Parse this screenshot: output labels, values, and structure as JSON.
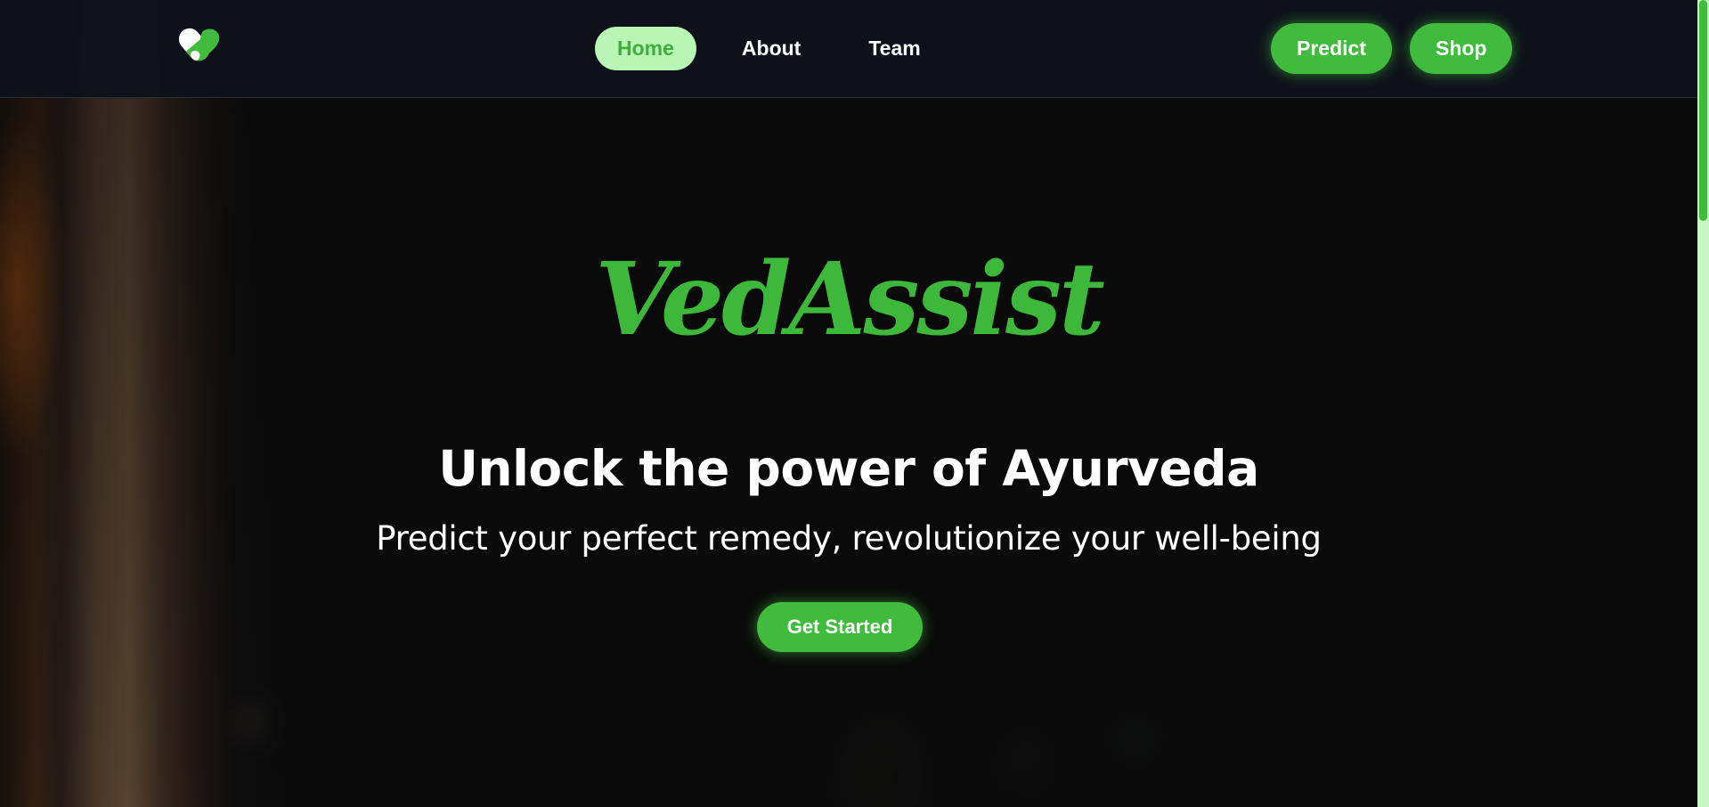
{
  "colors": {
    "accent": "#41bb3d",
    "accent_light": "#b9f5b5",
    "nav_background": "#0e121b",
    "page_background": "#0b0b0b",
    "text": "#ffffff"
  },
  "navbar": {
    "logo_icon": "capsule-heart-icon",
    "links": [
      {
        "label": "Home",
        "active": true
      },
      {
        "label": "About",
        "active": false
      },
      {
        "label": "Team",
        "active": false
      }
    ],
    "actions": [
      {
        "label": "Predict"
      },
      {
        "label": "Shop"
      }
    ]
  },
  "hero": {
    "brand": "VedAssist",
    "headline": "Unlock the power of Ayurveda",
    "subheadline": "Predict your perfect remedy, revolutionize your well-being",
    "cta_label": "Get Started"
  },
  "scrollbar": {
    "position": 0
  }
}
